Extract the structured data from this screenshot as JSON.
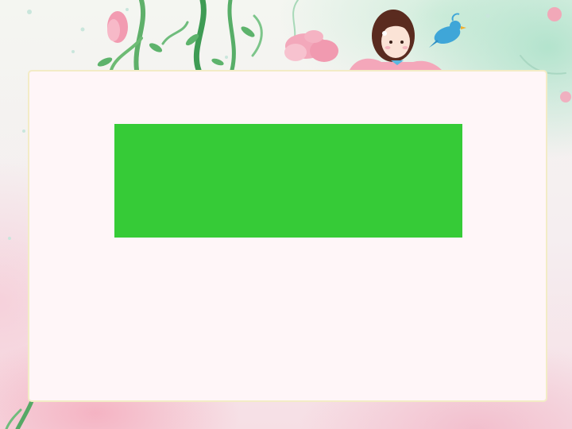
{
  "slide": {
    "background": "#f5eef0",
    "panel_color": "#fff6f8",
    "panel_border_color": "#f3ecc6"
  },
  "green_block": {
    "color": "#36cb37"
  },
  "decorations": [
    "vine",
    "flower",
    "girl",
    "bird"
  ]
}
